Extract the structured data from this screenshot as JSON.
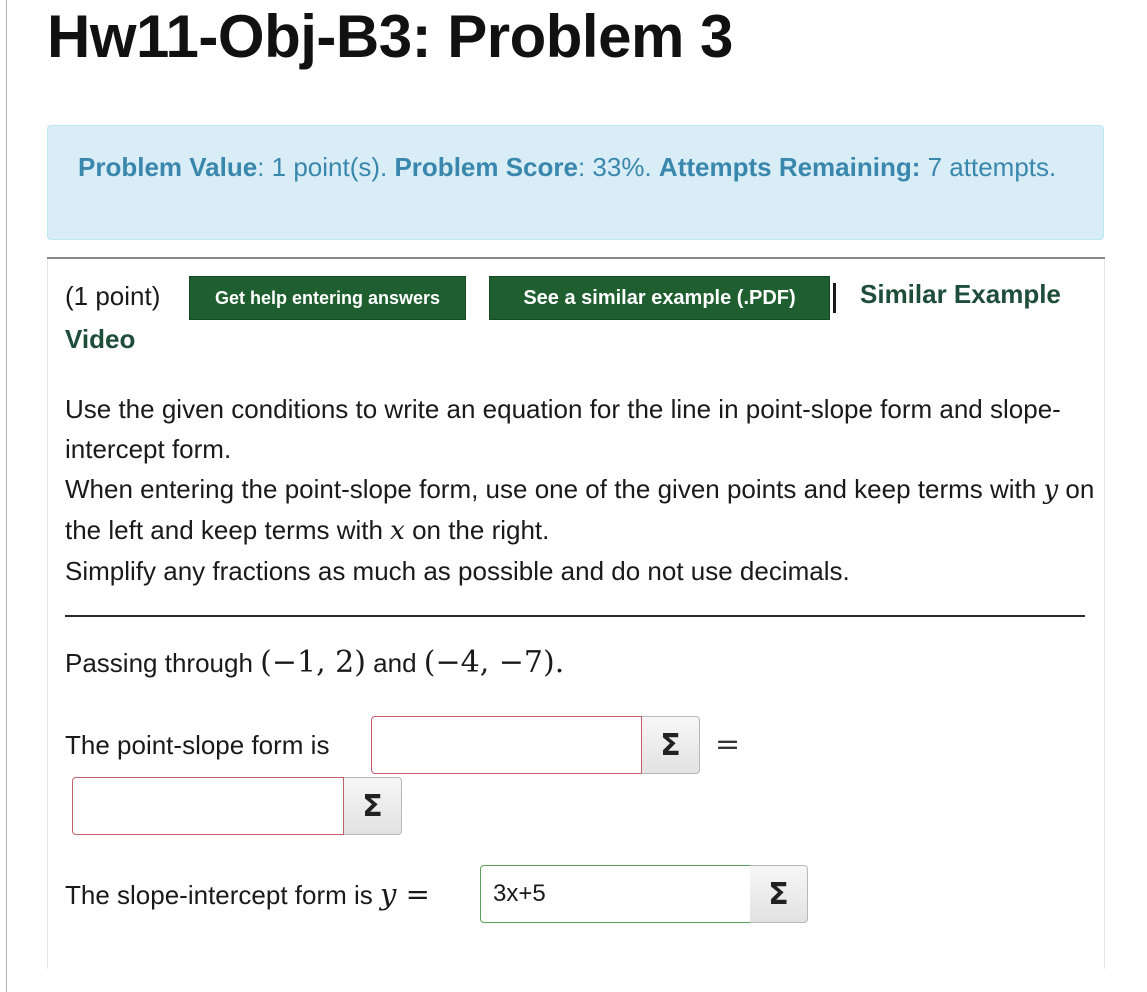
{
  "page_title": "Hw11-Obj-B3: Problem 3",
  "info": {
    "value_label": "Problem Value",
    "value_text": ": 1 point(s). ",
    "score_label": "Problem Score",
    "score_text": ": 33%. ",
    "attempts_label": "Attempts Remaining:",
    "attempts_text": " 7 attempts."
  },
  "problem_header": {
    "points": "(1 point)",
    "help_button": "Get help entering answers",
    "example_button": "See a similar example (.PDF)",
    "video_link_part1": "Similar Example",
    "video_link_part2": "Video"
  },
  "instructions": {
    "line1": "Use the given conditions to write an equation for the line in point-slope form and slope-intercept form.",
    "line2_a": "When entering the point-slope form, use one of the given points and keep terms with ",
    "line2_y": "y",
    "line2_b": " on the left and keep terms with ",
    "line2_x": "x",
    "line2_c": " on the right.",
    "line3": "Simplify any fractions as much as possible and do not use decimals."
  },
  "given": {
    "prefix": "Passing through ",
    "point1": "(−1, 2)",
    "middle": " and ",
    "point2": "(−4, −7)",
    "suffix": "."
  },
  "point_slope": {
    "label": "The point-slope form is",
    "left_value": "",
    "right_value": "",
    "equals": "="
  },
  "slope_intercept": {
    "label": "The slope-intercept form is ",
    "var": "y",
    "equals": " =",
    "value": "3x+5"
  },
  "sigma_icon": "Σ"
}
